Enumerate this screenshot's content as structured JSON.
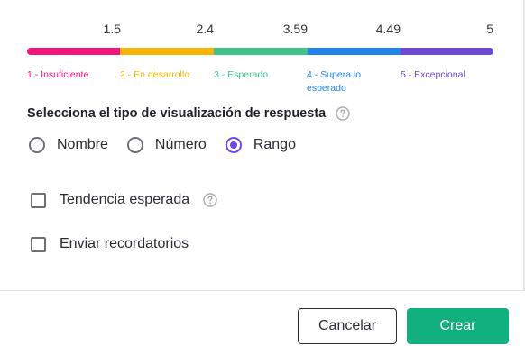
{
  "scale": {
    "ticks": [
      "1.5",
      "2.4",
      "3.59",
      "4.49",
      "5"
    ],
    "levels": [
      {
        "label": "1.- Insuficiente",
        "color": "#f0157a"
      },
      {
        "label": "2.- En desarrollo",
        "color": "#f7b500"
      },
      {
        "label": "3.- Esperado",
        "color": "#3ec48b"
      },
      {
        "label": "4.- Supera lo esperado",
        "color": "#1f83ea"
      },
      {
        "label": "5.- Excepcional",
        "color": "#6c48d9"
      }
    ]
  },
  "visualization": {
    "title": "Selecciona el tipo de visualización de respuesta",
    "help_icon": "question-circle-icon",
    "options": [
      {
        "label": "Nombre",
        "selected": false
      },
      {
        "label": "Número",
        "selected": false
      },
      {
        "label": "Rango",
        "selected": true
      }
    ]
  },
  "checkboxes": {
    "trend_label": "Tendencia esperada",
    "trend_checked": false,
    "reminders_label": "Enviar recordatorios",
    "reminders_checked": false
  },
  "footer": {
    "cancel_label": "Cancelar",
    "create_label": "Crear",
    "accent": "#13b07f",
    "selection_color": "#6f48e6"
  }
}
